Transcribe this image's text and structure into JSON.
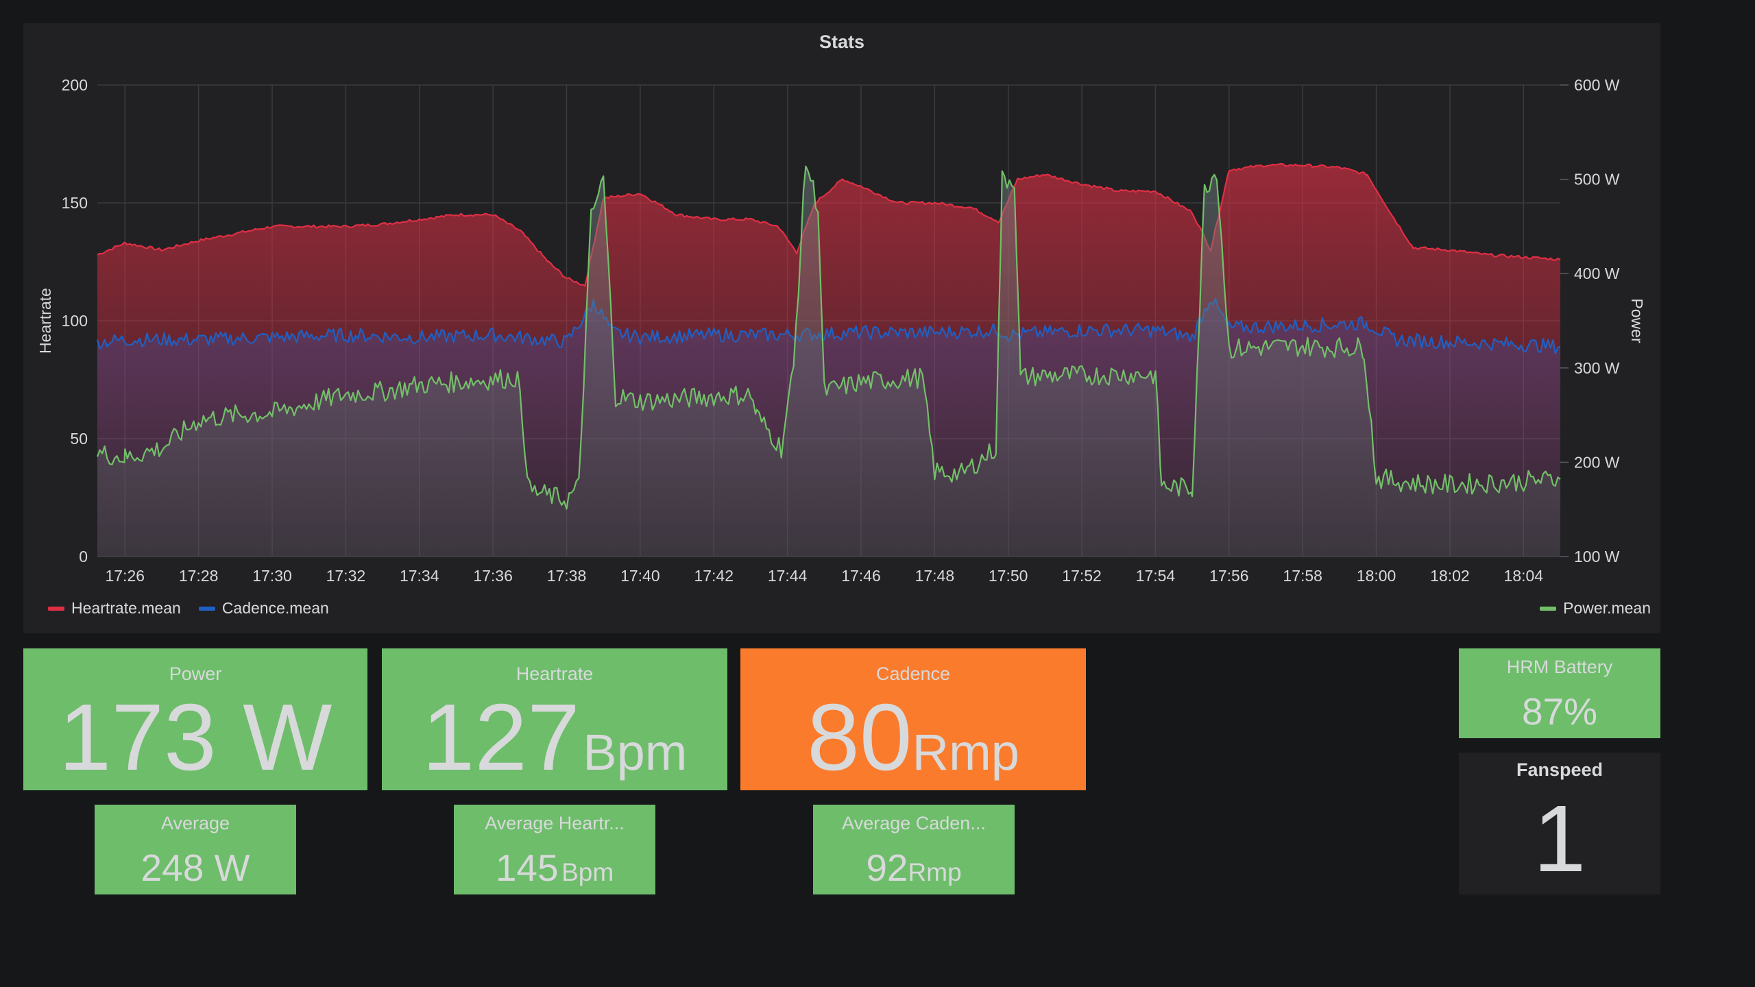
{
  "stats_panel": {
    "title": "Stats",
    "legend": {
      "heartrate": "Heartrate.mean",
      "cadence": "Cadence.mean",
      "power": "Power.mean"
    }
  },
  "colors": {
    "background": "#161719",
    "panel": "#212124",
    "heartrate": "#e02f44",
    "cadence": "#1f60c4",
    "power": "#73bf69",
    "stat_green": "#6dbd6b",
    "stat_orange": "#fa7b2c"
  },
  "chart_data": {
    "type": "area",
    "title": "Stats",
    "x_ticks": [
      "17:26",
      "17:28",
      "17:30",
      "17:32",
      "17:34",
      "17:36",
      "17:38",
      "17:40",
      "17:42",
      "17:44",
      "17:46",
      "17:48",
      "17:50",
      "17:52",
      "17:54",
      "17:56",
      "17:58",
      "18:00",
      "18:02",
      "18:04"
    ],
    "x_range": [
      "17:25:15",
      "18:05:00"
    ],
    "y_left": {
      "label": "Heartrate",
      "range": [
        0,
        200
      ],
      "ticks": [
        "0",
        "50",
        "100",
        "150",
        "200"
      ]
    },
    "y_right": {
      "label": "Power",
      "range": [
        100,
        600
      ],
      "ticks": [
        "100 W",
        "200 W",
        "300 W",
        "400 W",
        "500 W",
        "600 W"
      ]
    },
    "grid": true,
    "legend_placement": "bottom",
    "series": [
      {
        "name": "Heartrate.mean",
        "axis": "left",
        "x": [
          "17:25:15",
          "17:26:00",
          "17:27:00",
          "17:28:00",
          "17:29:00",
          "17:30:00",
          "17:31:00",
          "17:32:00",
          "17:33:00",
          "17:34:00",
          "17:35:00",
          "17:36:00",
          "17:36:45",
          "17:37:30",
          "17:38:00",
          "17:38:30",
          "17:39:00",
          "17:40:00",
          "17:41:00",
          "17:42:00",
          "17:43:00",
          "17:43:45",
          "17:44:15",
          "17:44:45",
          "17:45:30",
          "17:46:00",
          "17:47:00",
          "17:48:00",
          "17:49:00",
          "17:49:45",
          "17:50:15",
          "17:51:00",
          "17:52:00",
          "17:53:00",
          "17:54:00",
          "17:55:00",
          "17:55:30",
          "17:56:00",
          "17:57:00",
          "17:58:00",
          "17:59:00",
          "17:59:45",
          "18:00:30",
          "18:01:00",
          "18:02:00",
          "18:03:00",
          "18:04:00",
          "18:05:00"
        ],
        "values": [
          128,
          133,
          130,
          134,
          137,
          140,
          140,
          140,
          141,
          143,
          145,
          145,
          138,
          125,
          118,
          115,
          152,
          154,
          145,
          143,
          143,
          140,
          129,
          150,
          160,
          157,
          150,
          150,
          148,
          142,
          160,
          162,
          158,
          155,
          155,
          146,
          130,
          164,
          166,
          166,
          165,
          162,
          143,
          131,
          130,
          128,
          127,
          126
        ]
      },
      {
        "name": "Cadence.mean",
        "axis": "left",
        "x": [
          "17:25:15",
          "17:26:00",
          "17:28:00",
          "17:30:00",
          "17:32:00",
          "17:34:00",
          "17:36:00",
          "17:38:00",
          "17:38:45",
          "17:39:15",
          "17:40:00",
          "17:42:00",
          "17:44:00",
          "17:46:00",
          "17:48:00",
          "17:49:45",
          "17:50:00",
          "17:52:00",
          "17:54:00",
          "17:55:00",
          "17:55:30",
          "17:56:00",
          "17:58:00",
          "17:59:45",
          "18:00:30",
          "18:02:00",
          "18:04:00",
          "18:05:00"
        ],
        "values": [
          91,
          92,
          92,
          93,
          94,
          93,
          94,
          91,
          108,
          95,
          93,
          94,
          94,
          95,
          95,
          96,
          94,
          96,
          96,
          93,
          110,
          97,
          98,
          99,
          92,
          91,
          90,
          89
        ]
      },
      {
        "name": "Power.mean",
        "axis": "right",
        "x": [
          "17:25:15",
          "17:26:00",
          "17:27:00",
          "17:28:00",
          "17:29:00",
          "17:30:00",
          "17:31:00",
          "17:32:00",
          "17:33:00",
          "17:34:00",
          "17:35:00",
          "17:36:00",
          "17:36:40",
          "17:37:00",
          "17:38:00",
          "17:38:20",
          "17:38:40",
          "17:39:00",
          "17:39:20",
          "17:40:00",
          "17:41:00",
          "17:42:00",
          "17:43:00",
          "17:43:10",
          "17:43:50",
          "17:44:10",
          "17:44:30",
          "17:44:50",
          "17:45:00",
          "17:46:00",
          "17:47:00",
          "17:47:40",
          "17:48:00",
          "17:48:45",
          "17:49:40",
          "17:49:50",
          "17:50:10",
          "17:50:20",
          "17:51:00",
          "17:52:00",
          "17:53:00",
          "17:54:00",
          "17:54:10",
          "17:55:00",
          "17:55:20",
          "17:55:40",
          "17:56:00",
          "17:57:00",
          "17:58:00",
          "17:59:00",
          "17:59:30",
          "17:59:40",
          "18:00:00",
          "18:01:00",
          "18:02:00",
          "18:03:00",
          "18:04:00",
          "18:05:00"
        ],
        "values": [
          210,
          205,
          215,
          245,
          250,
          252,
          262,
          272,
          275,
          282,
          285,
          288,
          290,
          170,
          160,
          175,
          460,
          500,
          270,
          265,
          267,
          270,
          272,
          250,
          215,
          300,
          520,
          470,
          275,
          285,
          288,
          290,
          190,
          188,
          215,
          500,
          500,
          290,
          292,
          292,
          293,
          293,
          175,
          172,
          490,
          510,
          320,
          322,
          323,
          322,
          322,
          320,
          183,
          178,
          176,
          178,
          180,
          182
        ]
      }
    ]
  },
  "stats": {
    "power": {
      "title": "Power",
      "value": "173",
      "unit": "W"
    },
    "heartrate": {
      "title": "Heartrate",
      "value": "127",
      "unit": "Bpm"
    },
    "cadence": {
      "title": "Cadence",
      "value": "80",
      "unit": "Rmp"
    },
    "avg_power": {
      "title": "Average",
      "value": "248",
      "unit": "W"
    },
    "avg_heartrate": {
      "title": "Average Heartr...",
      "value": "145",
      "unit": "Bpm"
    },
    "avg_cadence": {
      "title": "Average Caden...",
      "value": "92",
      "unit": "Rmp"
    },
    "hrm_battery": {
      "title": "HRM Battery",
      "value": "87%"
    },
    "fanspeed": {
      "title": "Fanspeed",
      "value": "1"
    }
  }
}
